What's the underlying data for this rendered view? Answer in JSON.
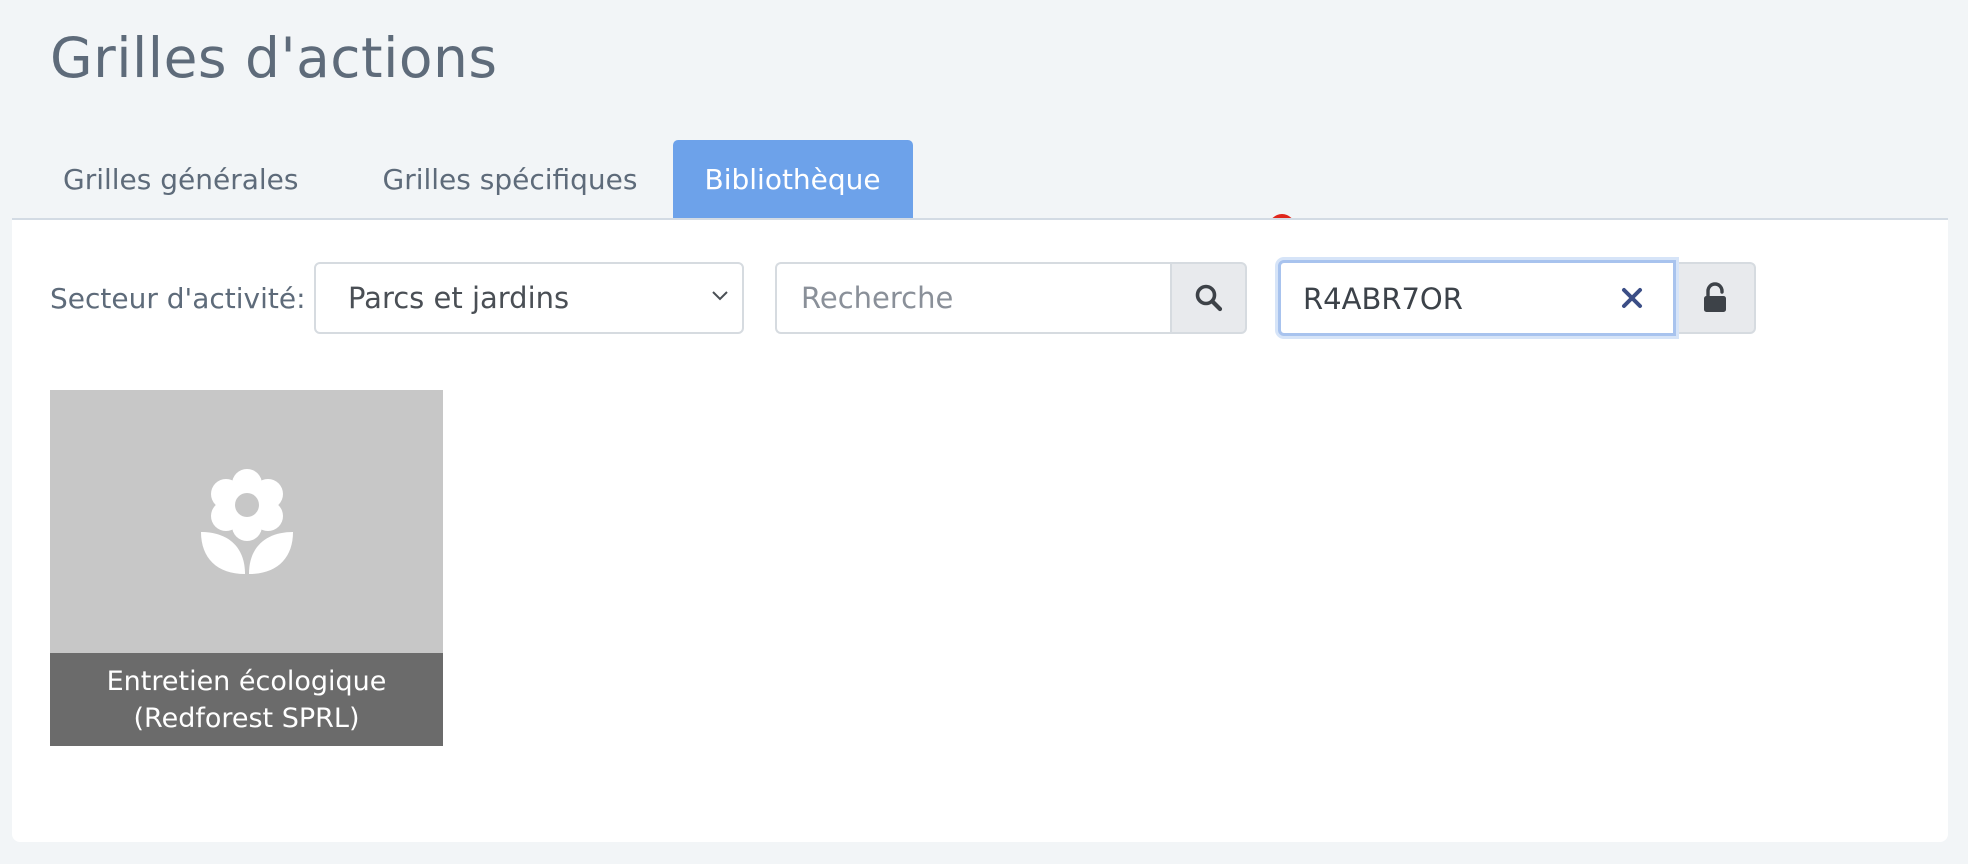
{
  "page": {
    "title": "Grilles d'actions"
  },
  "tabs": [
    {
      "label": "Grilles générales",
      "active": false
    },
    {
      "label": "Grilles spécifiques",
      "active": false
    },
    {
      "label": "Bibliothèque",
      "active": true
    }
  ],
  "filters": {
    "sector_label": "Secteur d'activité:",
    "sector_value": "Parcs et jardins",
    "search_placeholder": "Recherche",
    "search_value": "",
    "code_value": "R4ABR7OR"
  },
  "icons": {
    "sector_chevron": "chevron-down-icon",
    "search": "search-icon",
    "clear": "close-icon",
    "lock": "unlock-icon",
    "card": "flower-icon"
  },
  "colors": {
    "active_tab": "#6da2ea",
    "indicator": "#e0261c",
    "card_image_bg": "#c7c7c7",
    "card_caption_bg": "#6b6b6b"
  },
  "library": {
    "cards": [
      {
        "title_line1": "Entretien écologique",
        "title_line2": "(Redforest SPRL)"
      }
    ]
  }
}
